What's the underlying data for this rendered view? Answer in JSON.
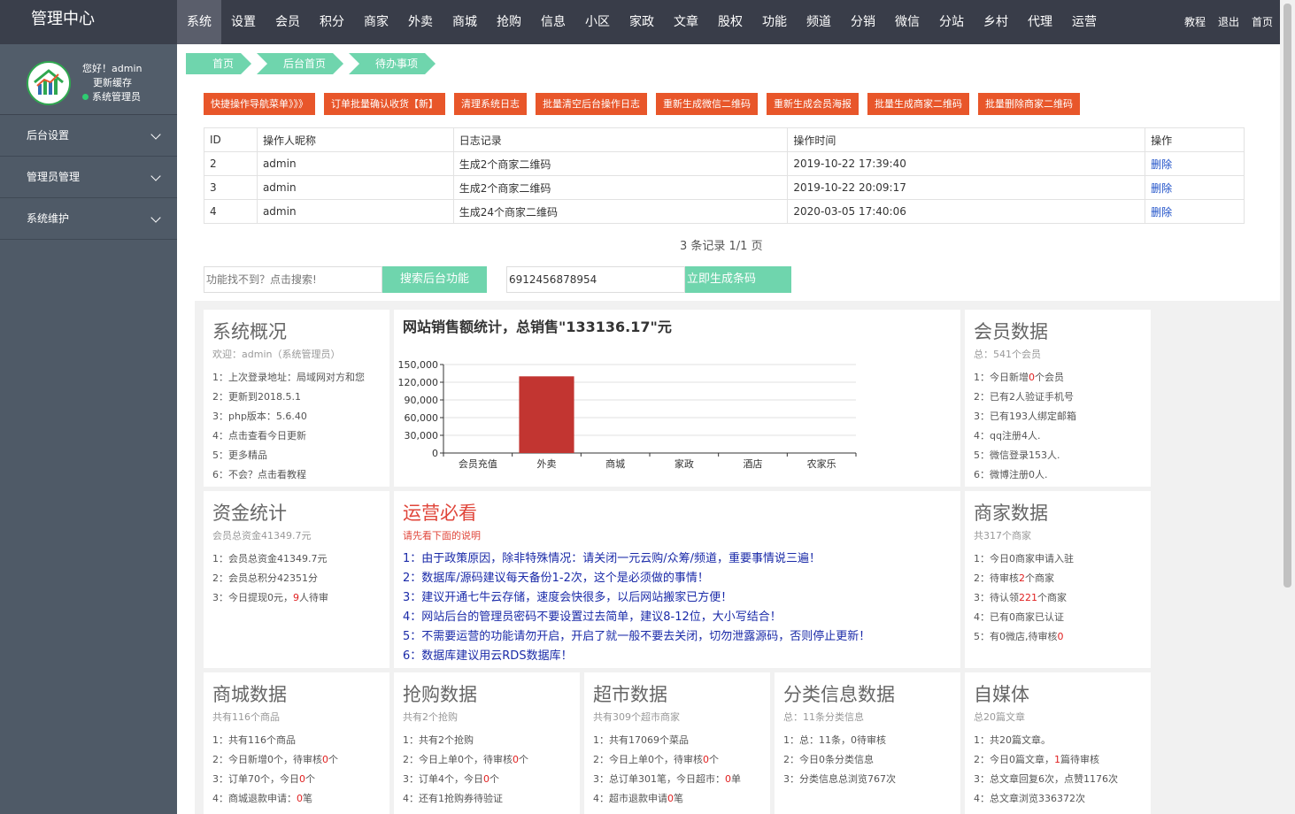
{
  "app": {
    "title": "管理中心"
  },
  "topnav": [
    "系统",
    "设置",
    "会员",
    "积分",
    "商家",
    "外卖",
    "商城",
    "抢购",
    "信息",
    "小区",
    "家政",
    "文章",
    "股权",
    "功能",
    "频道",
    "分销",
    "微信",
    "分站",
    "乡村",
    "代理",
    "运营"
  ],
  "topright": [
    "教程",
    "退出",
    "首页"
  ],
  "user": {
    "greeting": "您好！admin",
    "cache": "更新缓存",
    "role": "系统管理员"
  },
  "sidebar": [
    {
      "label": "后台设置"
    },
    {
      "label": "管理员管理"
    },
    {
      "label": "系统维护"
    }
  ],
  "breadcrumb": [
    "首页",
    "后台首页",
    "待办事项"
  ],
  "actions": [
    "快捷操作导航菜单》》》",
    "订单批量确认收货【新】",
    "清理系统日志",
    "批量清空后台操作日志",
    "重新生成微信二维码",
    "重新生成会员海报",
    "批量生成商家二维码",
    "批量删除商家二维码"
  ],
  "log_table": {
    "headers": [
      "ID",
      "操作人昵称",
      "日志记录",
      "操作时间",
      "操作"
    ],
    "rows": [
      {
        "id": "2",
        "user": "admin",
        "record": "生成2个商家二维码",
        "time": "2019-10-22 17:39:40",
        "op": "删除"
      },
      {
        "id": "3",
        "user": "admin",
        "record": "生成2个商家二维码",
        "time": "2019-10-22 20:09:17",
        "op": "删除"
      },
      {
        "id": "4",
        "user": "admin",
        "record": "生成24个商家二维码",
        "time": "2020-03-05 17:40:06",
        "op": "删除"
      }
    ]
  },
  "pager": "3 条记录 1/1 页",
  "search": {
    "placeholder": "功能找不到？点击搜索!",
    "button": "搜索后台功能"
  },
  "barcode": {
    "value": "6912456878954",
    "button": "立即生成条码"
  },
  "overview": {
    "title": "系统概况",
    "sub": "欢迎：admin（系统管理员）",
    "lines": [
      "1：上次登录地址：局域网对方和您",
      "2：更新到2018.5.1",
      "3：php版本：5.6.40",
      "4：点击查看今日更新",
      "5：更多精品",
      "6：不会？点击看教程"
    ]
  },
  "chart_data": {
    "type": "bar",
    "title": "网站销售额统计，总销售\"133136.17\"元",
    "categories": [
      "会员充值",
      "外卖",
      "商城",
      "家政",
      "酒店",
      "农家乐"
    ],
    "values": [
      0,
      130000,
      0,
      0,
      0,
      0
    ],
    "ylim": [
      0,
      150000
    ],
    "yticks": [
      "150,000",
      "120,000",
      "90,000",
      "60,000",
      "30,000",
      "0"
    ],
    "bar_color": "#c23531",
    "grid": true
  },
  "members": {
    "title": "会员数据",
    "sub": "总：541个会员",
    "lines": [
      {
        "pre": "1：今日新增",
        "red": "0",
        "post": "个会员"
      },
      {
        "pre": "2：已有2人验证手机号",
        "red": "",
        "post": ""
      },
      {
        "pre": "3：已有193人绑定邮箱",
        "red": "",
        "post": ""
      },
      {
        "pre": "4：qq注册4人.",
        "red": "",
        "post": ""
      },
      {
        "pre": "5：微信登录153人.",
        "red": "",
        "post": ""
      },
      {
        "pre": "6：微博注册0人.",
        "red": "",
        "post": ""
      }
    ]
  },
  "funds": {
    "title": "资金统计",
    "sub": "会员总资金41349.7元",
    "lines": [
      {
        "pre": "1：会员总资金41349.7元",
        "red": "",
        "post": ""
      },
      {
        "pre": "2：会员总积分42351分",
        "red": "",
        "post": ""
      },
      {
        "pre": "3：今日提现0元，",
        "red": "9",
        "post": "人待审"
      }
    ]
  },
  "ops": {
    "title": "运营必看",
    "sub": "请先看下面的说明",
    "lines": [
      "1：由于政策原因，除非特殊情况：请关闭一元云购/众筹/频道，重要事情说三遍！",
      "2：数据库/源码建议每天备份1-2次，这个是必须做的事情！",
      "3：建议开通七牛云存储，速度会快很多，以后网站搬家已方便！",
      "4：网站后台的管理员密码不要设置过去简单，建议8-12位，大小写结合！",
      "5：不需要运营的功能请勿开启，开启了就一般不要去关闭，切勿泄露源码，否则停止更新！",
      "6：数据库建议用云RDS数据库！"
    ]
  },
  "merchants": {
    "title": "商家数据",
    "sub": "共317个商家",
    "lines": [
      {
        "pre": "1：今日0商家申请入驻",
        "red": "",
        "post": ""
      },
      {
        "pre": "2：待审核",
        "red": "2",
        "post": "个商家"
      },
      {
        "pre": "3：待认领",
        "red": "221",
        "post": "个商家"
      },
      {
        "pre": "4：已有0商家已认证",
        "red": "",
        "post": ""
      },
      {
        "pre": "5：有0微店,待审核",
        "red": "0",
        "post": ""
      }
    ]
  },
  "mall": {
    "title": "商城数据",
    "sub": "共有116个商品",
    "lines": [
      {
        "pre": "1：共有116个商品",
        "red": "",
        "post": ""
      },
      {
        "pre": "2：今日新增0个，待审核",
        "red": "0",
        "post": "个"
      },
      {
        "pre": "3：订单70个，今日",
        "red": "0",
        "post": "个"
      },
      {
        "pre": "4：商城退款申请：",
        "red": "0",
        "post": "笔"
      }
    ]
  },
  "flash": {
    "title": "抢购数据",
    "sub": "共有2个抢购",
    "lines": [
      {
        "pre": "1：共有2个抢购",
        "red": "",
        "post": ""
      },
      {
        "pre": "2：今日上单0个，待审核",
        "red": "0",
        "post": "个"
      },
      {
        "pre": "3：订单4个，今日",
        "red": "0",
        "post": "个"
      },
      {
        "pre": "4：还有1抢购券待验证",
        "red": "",
        "post": ""
      }
    ]
  },
  "market": {
    "title": "超市数据",
    "sub": "共有309个超市商家",
    "lines": [
      {
        "pre": "1：共有17069个菜品",
        "red": "",
        "post": ""
      },
      {
        "pre": "2：今日上单0个，待审核",
        "red": "0",
        "post": "个"
      },
      {
        "pre": "3：总订单301笔，今日超市：",
        "red": "0",
        "post": "单"
      },
      {
        "pre": "4：超市退款申请",
        "red": "0",
        "post": "笔"
      }
    ]
  },
  "classified": {
    "title": "分类信息数据",
    "sub": "总：11条分类信息",
    "lines": [
      {
        "pre": "1：总：11条，0待审核",
        "red": "",
        "post": ""
      },
      {
        "pre": "2：今日0条分类信息",
        "red": "",
        "post": ""
      },
      {
        "pre": "3：分类信息总浏览767次",
        "red": "",
        "post": ""
      }
    ]
  },
  "media": {
    "title": "自媒体",
    "sub": "总20篇文章",
    "lines": [
      {
        "pre": "1：共20篇文章。",
        "red": "",
        "post": ""
      },
      {
        "pre": "2：今日0篇文章，",
        "red": "1",
        "post": "篇待审核"
      },
      {
        "pre": "3：总文章回复6次，点赞1176次",
        "red": "",
        "post": ""
      },
      {
        "pre": "4：总文章浏览336372次",
        "red": "",
        "post": ""
      }
    ]
  }
}
